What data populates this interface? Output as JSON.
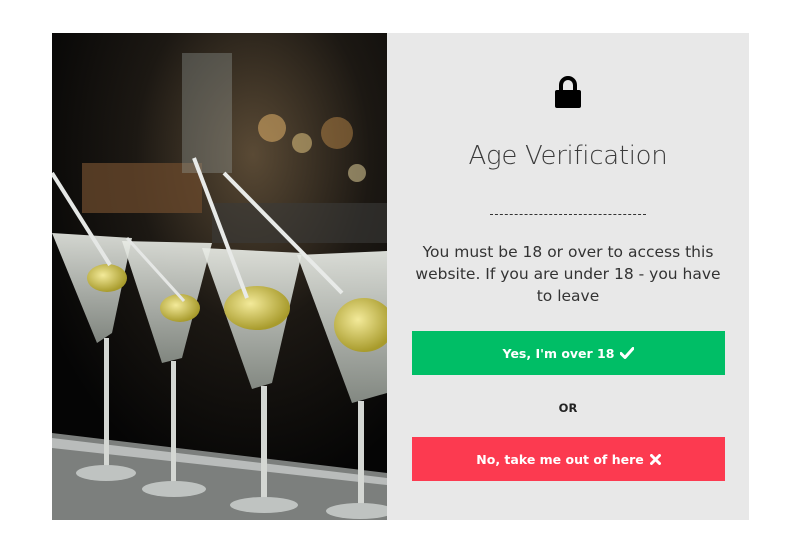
{
  "modal": {
    "image": {
      "description_icon": "martini-glasses-photo"
    },
    "lock_icon": "lock-icon",
    "title": "Age Verification",
    "message": "You must be 18 or over to access this website. If you are under 18 - you have to leave",
    "yes_button": {
      "label": "Yes, I'm over 18",
      "icon": "checkmark-icon",
      "color": "#00be66"
    },
    "or_label": "OR",
    "no_button": {
      "label": "No, take me out of here",
      "icon": "cross-icon",
      "color": "#fc3a50"
    },
    "panel_color": "#e8e8e8"
  }
}
